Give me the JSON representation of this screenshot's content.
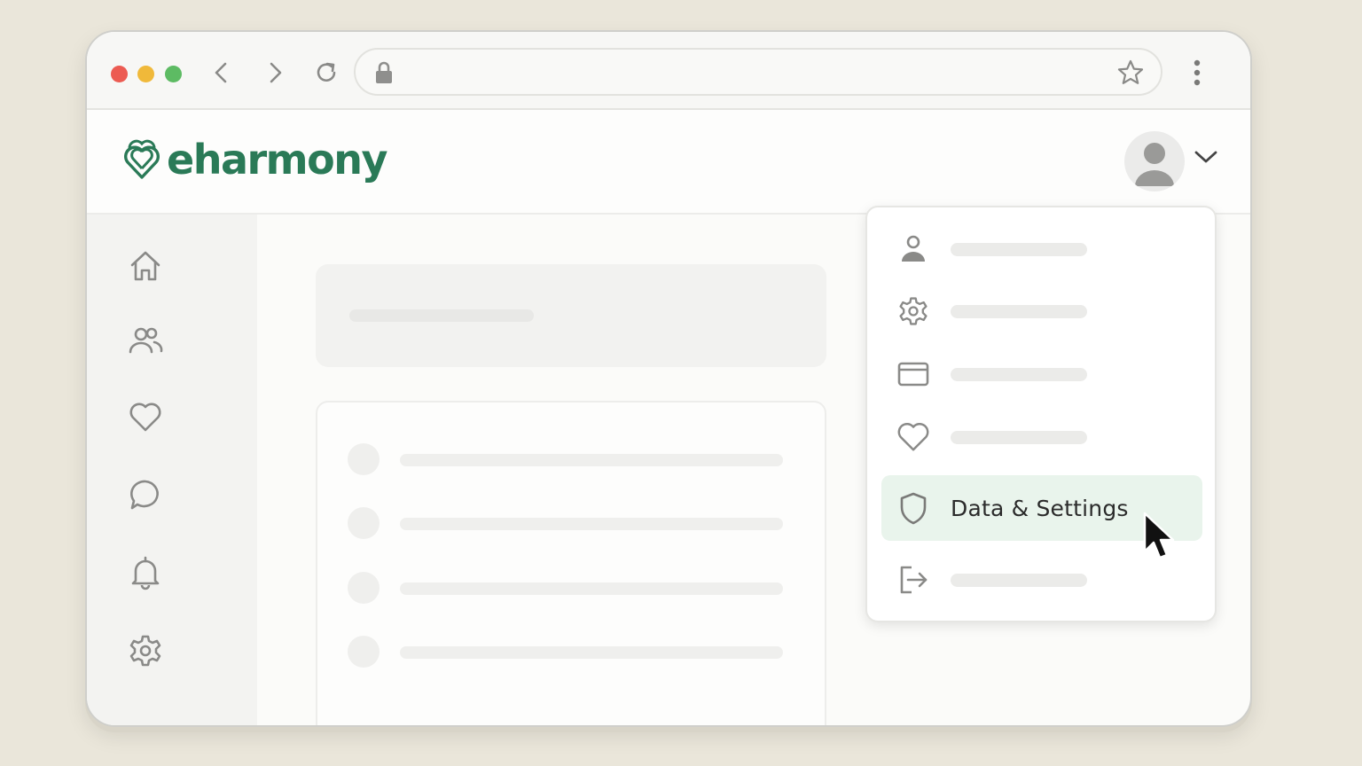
{
  "browser": {
    "traffic_lights": {
      "close": "#ec5b52",
      "minimize": "#f0b93a",
      "maximize": "#5dbb63"
    },
    "icons": [
      "back-icon",
      "forward-icon",
      "reload-icon",
      "lock-icon",
      "star-icon",
      "kebab-menu-icon"
    ]
  },
  "brand": {
    "name": "eharmony",
    "color": "#2a7a57"
  },
  "sidebar": {
    "items": [
      {
        "icon": "home-icon"
      },
      {
        "icon": "users-icon"
      },
      {
        "icon": "heart-icon"
      },
      {
        "icon": "chat-icon"
      },
      {
        "icon": "bell-icon"
      },
      {
        "icon": "gear-icon"
      }
    ]
  },
  "account_menu": {
    "items": [
      {
        "icon": "user-icon",
        "label": ""
      },
      {
        "icon": "gear-icon",
        "label": ""
      },
      {
        "icon": "card-icon",
        "label": ""
      },
      {
        "icon": "heart-icon",
        "label": ""
      },
      {
        "icon": "shield-icon",
        "label": "Data & Settings",
        "highlighted": true
      },
      {
        "icon": "logout-icon",
        "label": ""
      }
    ],
    "highlight_color": "#e9f4ec"
  }
}
